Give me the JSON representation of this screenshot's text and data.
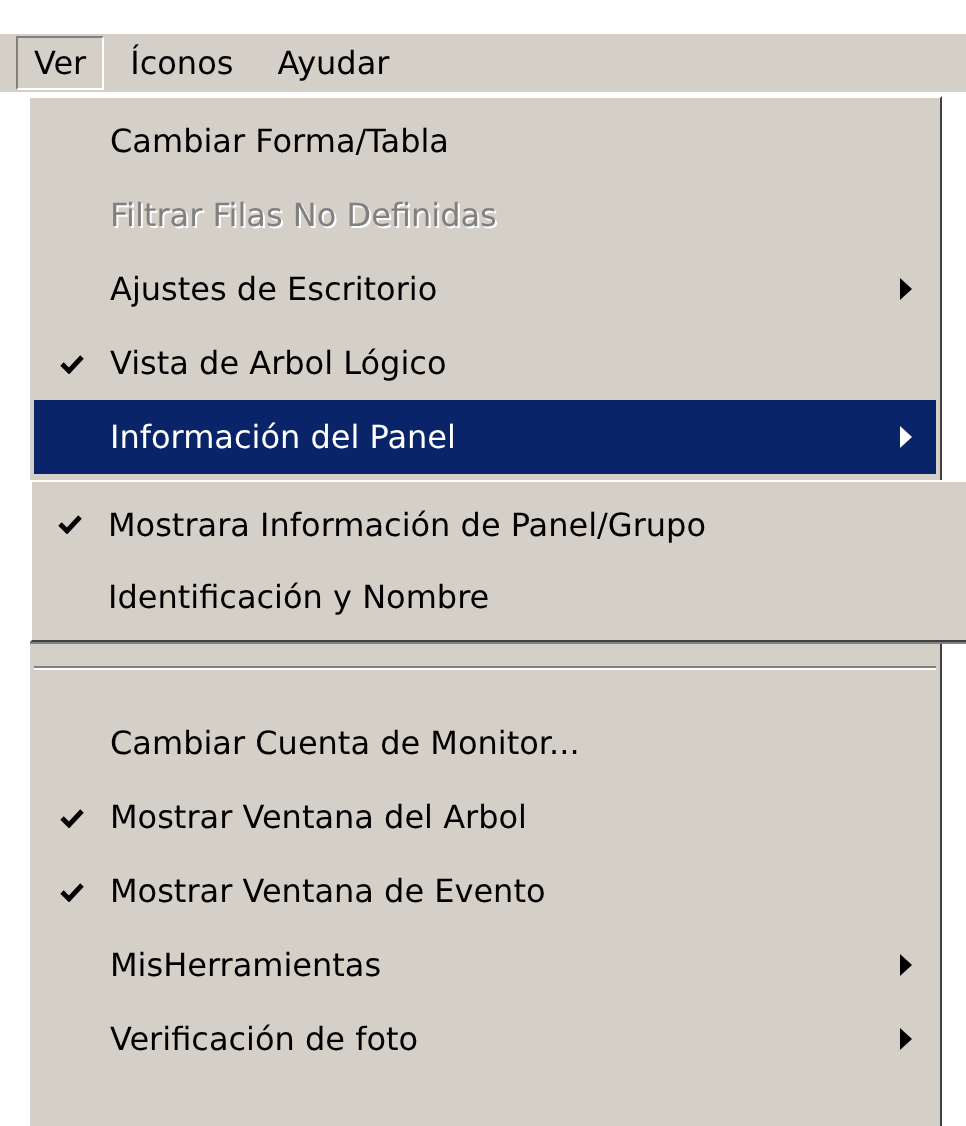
{
  "menu_bar": [
    {
      "label": "Ver",
      "selected": true
    },
    {
      "label": "Íconos",
      "selected": false
    },
    {
      "label": "Ayudar",
      "selected": false
    }
  ],
  "menu": {
    "items": [
      {
        "kind": "command",
        "label": "Cambiar Forma/Tabla",
        "checked": false,
        "disabled": false,
        "submenu": false,
        "selected": false
      },
      {
        "kind": "command",
        "label": "Filtrar Filas No Definidas",
        "checked": false,
        "disabled": true,
        "submenu": false,
        "selected": false
      },
      {
        "kind": "command",
        "label": "Ajustes de Escritorio",
        "checked": false,
        "disabled": false,
        "submenu": true,
        "selected": false
      },
      {
        "kind": "command",
        "label": "Vista de Arbol Lógico",
        "checked": true,
        "disabled": false,
        "submenu": false,
        "selected": false
      },
      {
        "kind": "command",
        "label": "Información del Panel",
        "checked": false,
        "disabled": false,
        "submenu": true,
        "selected": true
      },
      {
        "kind": "separator"
      },
      {
        "kind": "command",
        "label": "Cambiar Cuenta de Monitor...",
        "checked": false,
        "disabled": false,
        "submenu": false,
        "selected": false
      },
      {
        "kind": "command",
        "label": "Mostrar Ventana del Arbol",
        "checked": true,
        "disabled": false,
        "submenu": false,
        "selected": false
      },
      {
        "kind": "command",
        "label": "Mostrar Ventana de Evento",
        "checked": true,
        "disabled": false,
        "submenu": false,
        "selected": false
      },
      {
        "kind": "command",
        "label": "MisHerramientas",
        "checked": false,
        "disabled": false,
        "submenu": true,
        "selected": false
      },
      {
        "kind": "command",
        "label": "Verificación de foto",
        "checked": false,
        "disabled": false,
        "submenu": true,
        "selected": false
      }
    ]
  },
  "submenu": {
    "items": [
      {
        "label": "Mostrara Información de Panel/Grupo",
        "checked": true
      },
      {
        "label": "Identificación y Nombre",
        "checked": false
      }
    ]
  }
}
